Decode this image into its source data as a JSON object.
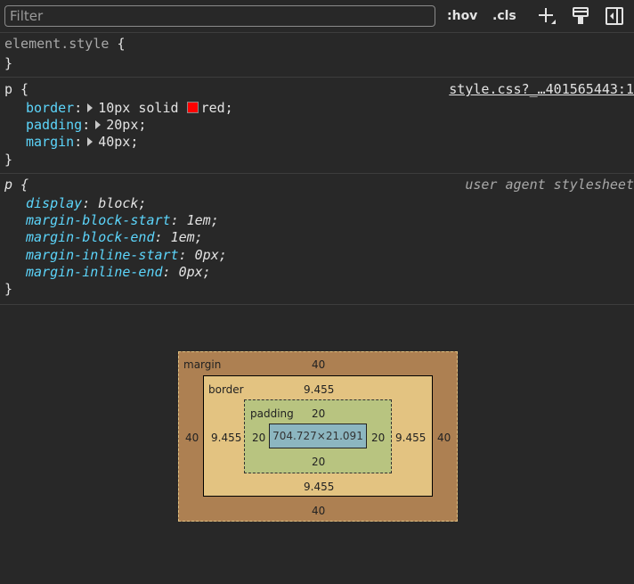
{
  "toolbar": {
    "filter_placeholder": "Filter",
    "hov_label": ":hov",
    "cls_label": ".cls",
    "icons": [
      "new-style-rule-icon",
      "paint-brush-icon",
      "toggle-sidebar-icon"
    ]
  },
  "element_style": {
    "selector": "element.style",
    "open": "{",
    "close": "}"
  },
  "rule1": {
    "selector": "p",
    "open": " {",
    "source": "style.css?_…401565443:1",
    "declarations": [
      {
        "prop": "border",
        "value": "10px solid ",
        "color_swatch": "#ff0000",
        "value_after": "red;"
      },
      {
        "prop": "padding",
        "value": "20px;"
      },
      {
        "prop": "margin",
        "value": "40px;"
      }
    ],
    "close": "}"
  },
  "rule2": {
    "selector": "p",
    "open": " {",
    "source": "user agent stylesheet",
    "declarations": [
      {
        "prop": "display",
        "value": "block;"
      },
      {
        "prop": "margin-block-start",
        "value": "1em;"
      },
      {
        "prop": "margin-block-end",
        "value": "1em;"
      },
      {
        "prop": "margin-inline-start",
        "value": "0px;"
      },
      {
        "prop": "margin-inline-end",
        "value": "0px;"
      }
    ],
    "close": "}"
  },
  "box_model": {
    "margin": {
      "label": "margin",
      "top": "40",
      "right": "40",
      "bottom": "40",
      "left": "40"
    },
    "border": {
      "label": "border",
      "top": "9.455",
      "right": "9.455",
      "bottom": "9.455",
      "left": "9.455"
    },
    "padding": {
      "label": "padding",
      "top": "20",
      "right": "20",
      "bottom": "20",
      "left": "20"
    },
    "content": "704.727×21.091",
    "colors": {
      "margin": "#ad8052",
      "border": "#e3c381",
      "padding": "#b8c480",
      "content": "#8cb6c0"
    }
  }
}
